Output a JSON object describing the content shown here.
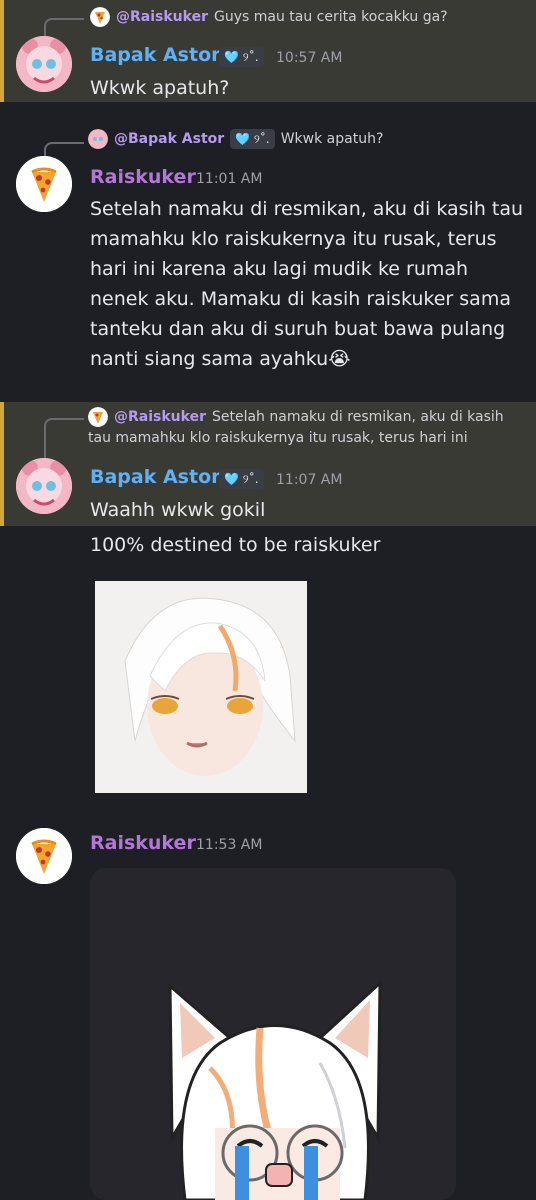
{
  "messages": [
    {
      "reply": {
        "author": "@Raiskuker",
        "text": "Guys mau tau cerita kocakku ga?"
      },
      "author": "Bapak Astor",
      "badge": "🩵 ୨˚.",
      "time": "10:57 AM",
      "lines": [
        "Wkwk apatuh?"
      ]
    },
    {
      "reply": {
        "author": "@Bapak Astor",
        "badge": "🩵 ୨˚.",
        "text": "Wkwk apatuh?"
      },
      "author": "Raiskuker",
      "time": "11:01 AM",
      "lines": [
        "Setelah namaku di resmikan, aku di kasih tau",
        "mamahku klo raiskukernya itu rusak, terus",
        "hari ini karena aku lagi mudik ke rumah",
        "nenek aku. Mamaku di kasih raiskuker sama",
        "tanteku dan aku di suruh buat bawa pulang",
        "nanti siang sama ayahku😭"
      ]
    },
    {
      "reply": {
        "author": "@Raiskuker",
        "text_line1": "Setelah namaku di resmikan, aku di kasih",
        "text_line2": "tau mamahku klo raiskukernya itu rusak, terus hari ini"
      },
      "author": "Bapak Astor",
      "badge": "🩵 ୨˚.",
      "time": "11:07 AM",
      "lines": [
        "Waahh wkwk gokil",
        "100% destined to be raiskuker"
      ]
    },
    {
      "author": "Raiskuker",
      "time": "11:53 AM"
    }
  ],
  "colors": {
    "background": "#1e1f24",
    "highlight": "#3a3a35",
    "highlight_bar": "#d4a73a",
    "bapak_name": "#5fb0f5",
    "rais_name": "#b476d8"
  }
}
